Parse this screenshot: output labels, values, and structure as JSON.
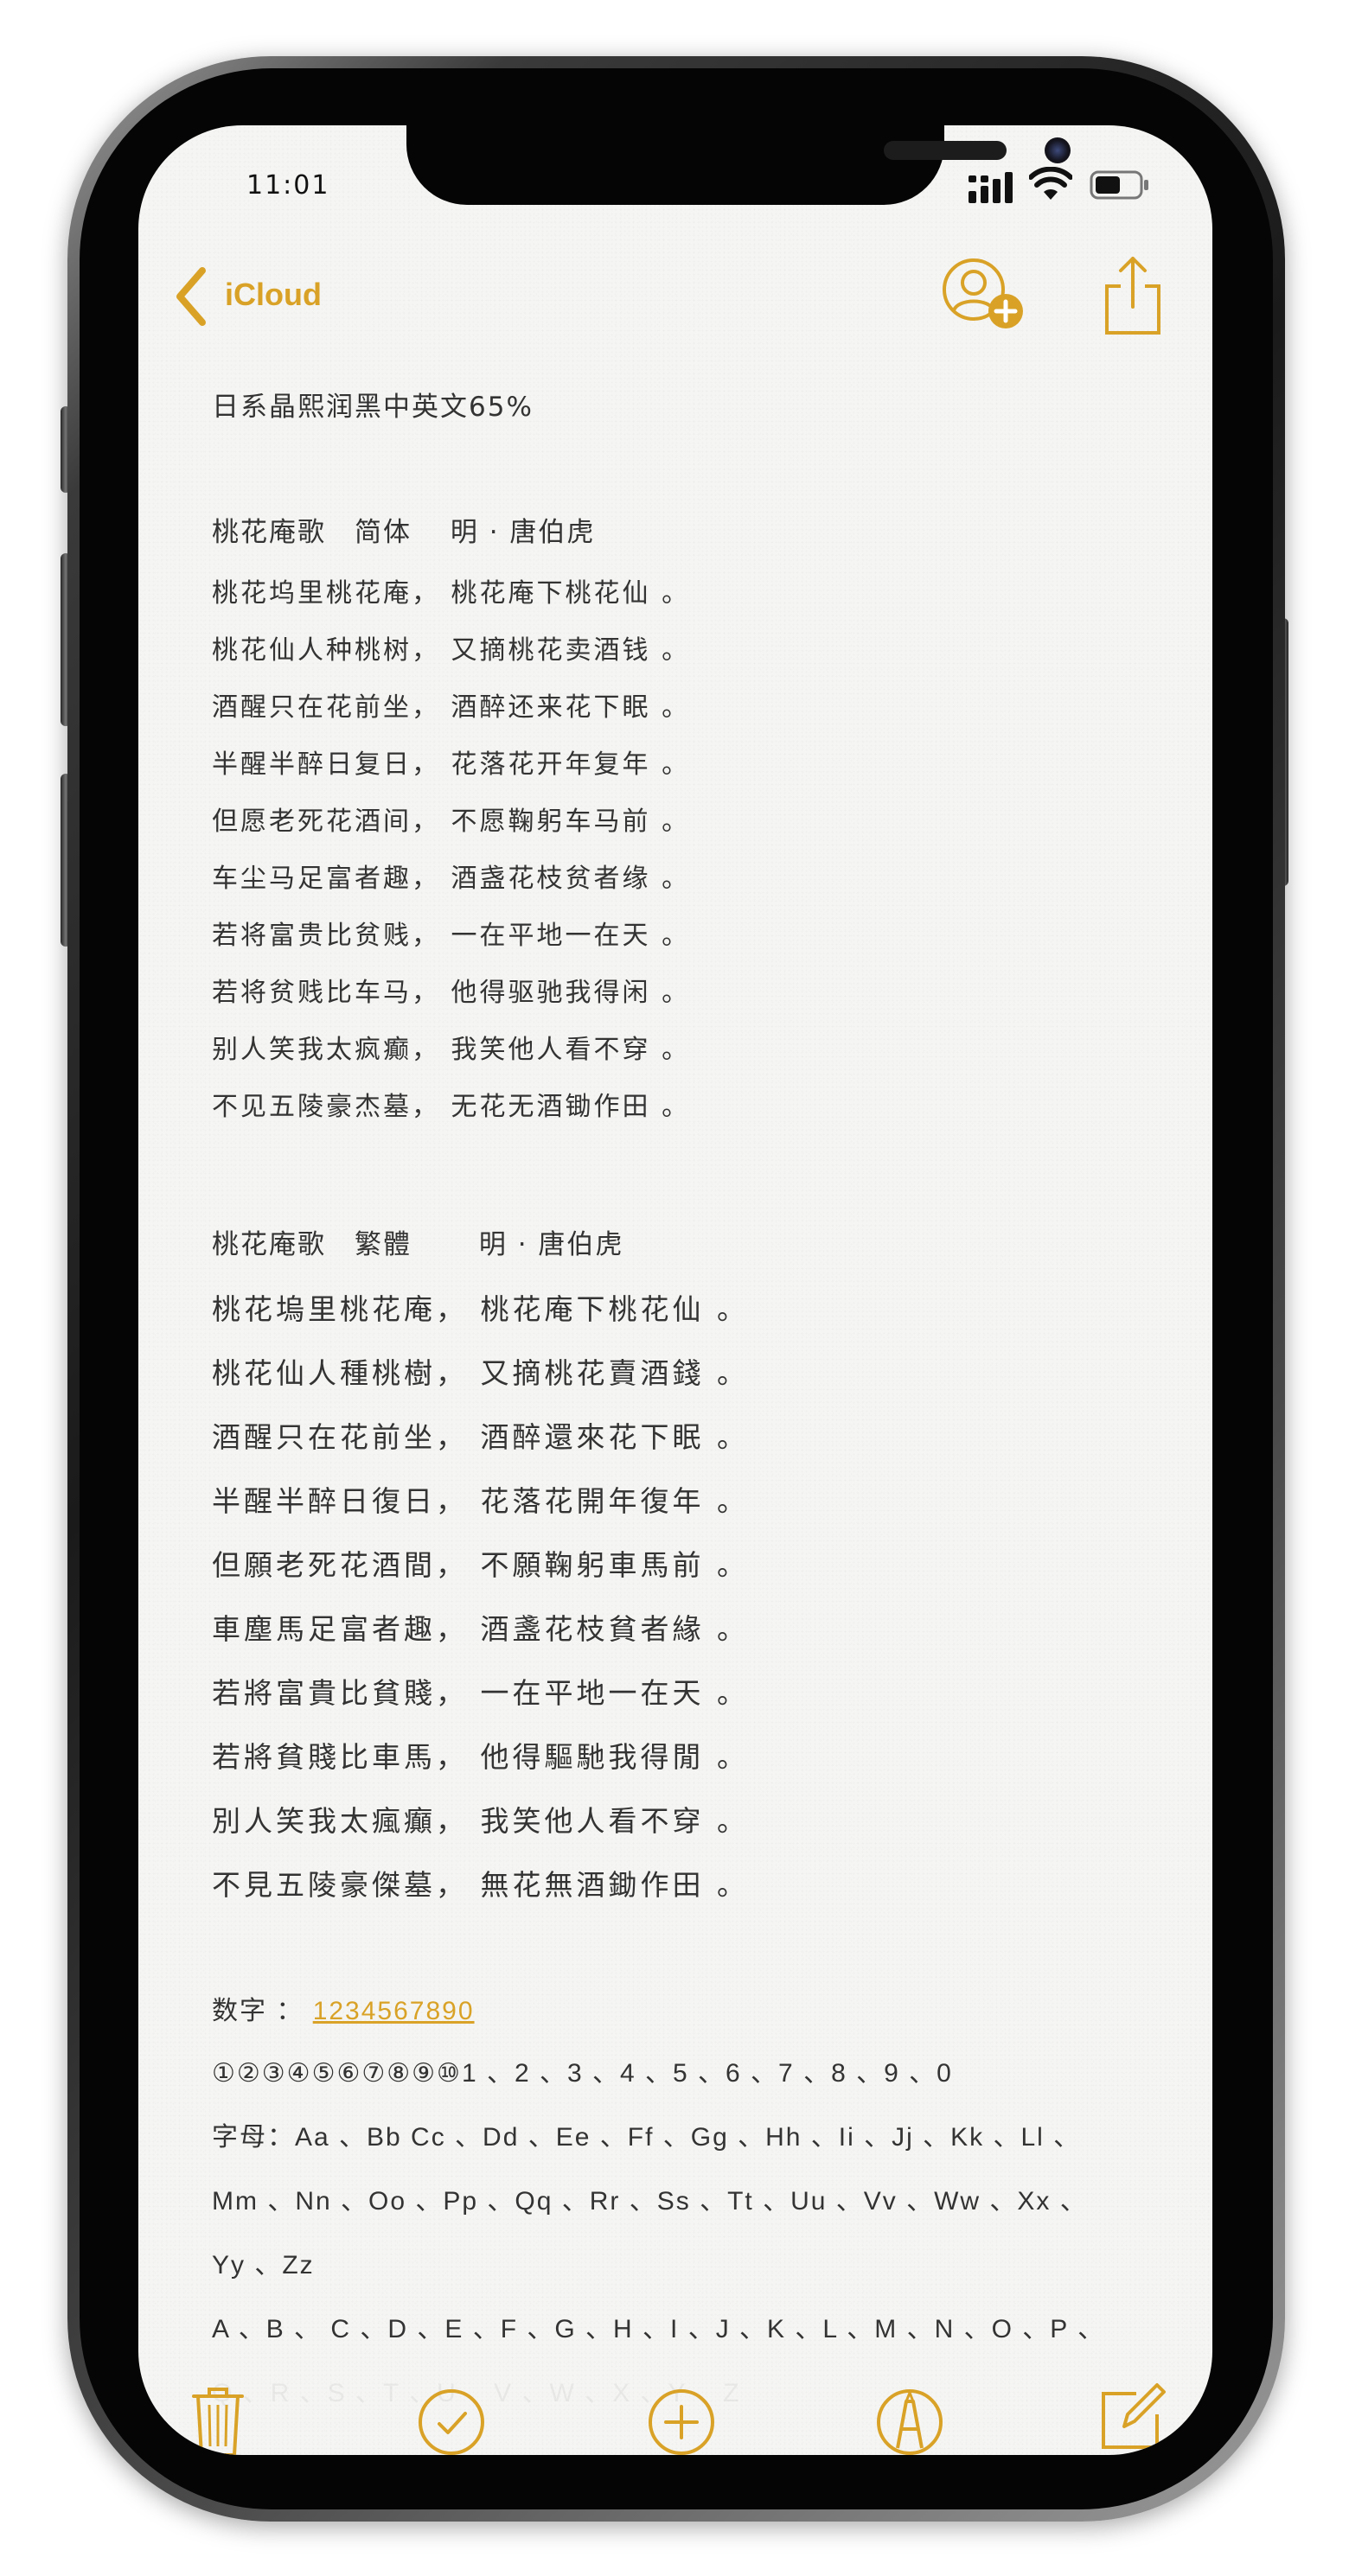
{
  "status": {
    "time": "11:01"
  },
  "nav": {
    "back_label": "iCloud"
  },
  "note": {
    "lines": [
      "日系晶熙润黑中英文65%",
      "桃花庵歌　简体　 明 · 唐伯虎",
      "桃花坞里桃花庵， 桃花庵下桃花仙 。",
      "桃花仙人种桃树， 又摘桃花卖酒钱 。",
      "酒醒只在花前坐， 酒醉还来花下眠 。",
      "半醒半醉日复日， 花落花开年复年 。",
      "但愿老死花酒间， 不愿鞠躬车马前 。",
      "车尘马足富者趣， 酒盏花枝贫者缘 。",
      "若将富贵比贫贱， 一在平地一在天 。",
      "若将贫贱比车马， 他得驱驰我得闲 。",
      "别人笑我太疯癫， 我笑他人看不穿 。",
      "不见五陵豪杰墓， 无花无酒锄作田 。",
      "桃花庵歌　繁體　　 明 · 唐伯虎",
      "桃花塢里桃花庵， 桃花庵下桃花仙 。",
      "桃花仙人種桃樹， 又摘桃花賣酒錢 。",
      "酒醒只在花前坐， 酒醉還來花下眠 。",
      "半醒半醉日復日， 花落花開年復年 。",
      "但願老死花酒間， 不願鞠躬車馬前 。",
      "車塵馬足富者趣， 酒盞花枝貧者緣 。",
      "若將富貴比貧賤， 一在平地一在天 。",
      "若將貧賤比車馬， 他得驅馳我得閒 。",
      "別人笑我太瘋癲， 我笑他人看不穿 。",
      "不見五陵豪傑墓， 無花無酒鋤作田 。"
    ],
    "digits_label": "数字 ：",
    "digits_link": "1234567890",
    "circled": "①②③④⑤⑥⑦⑧⑨⑩1 、2 、3 、4 、5 、6 、7 、8 、9 、0",
    "letters_1": "字母：Aa 、Bb Cc 、Dd 、Ee 、Ff 、Gg 、Hh 、Ii 、Jj 、Kk 、Ll 、",
    "letters_2": "Mm 、Nn 、Oo 、Pp 、Qq 、Rr 、Ss 、Tt 、Uu 、Vv 、Ww 、Xx 、",
    "letters_3": "Yy 、Zz",
    "letters_4": "A 、B 、 C 、D 、E 、F 、G 、H 、I 、J 、K 、L 、M 、N 、O 、P 、",
    "letters_5": "Q 、R 、S 、T 、U 、V 、W 、X 、Y 、Z"
  },
  "icons": {
    "back": "chevron-left-icon",
    "add_person": "add-person-icon",
    "share": "share-icon",
    "trash": "trash-icon",
    "checklist": "checkmark-circle-icon",
    "add": "plus-circle-icon",
    "markup": "markup-pen-icon",
    "compose": "compose-icon"
  },
  "colors": {
    "accent": "#d9a227",
    "text": "#333333",
    "background": "#f5f5f3"
  }
}
